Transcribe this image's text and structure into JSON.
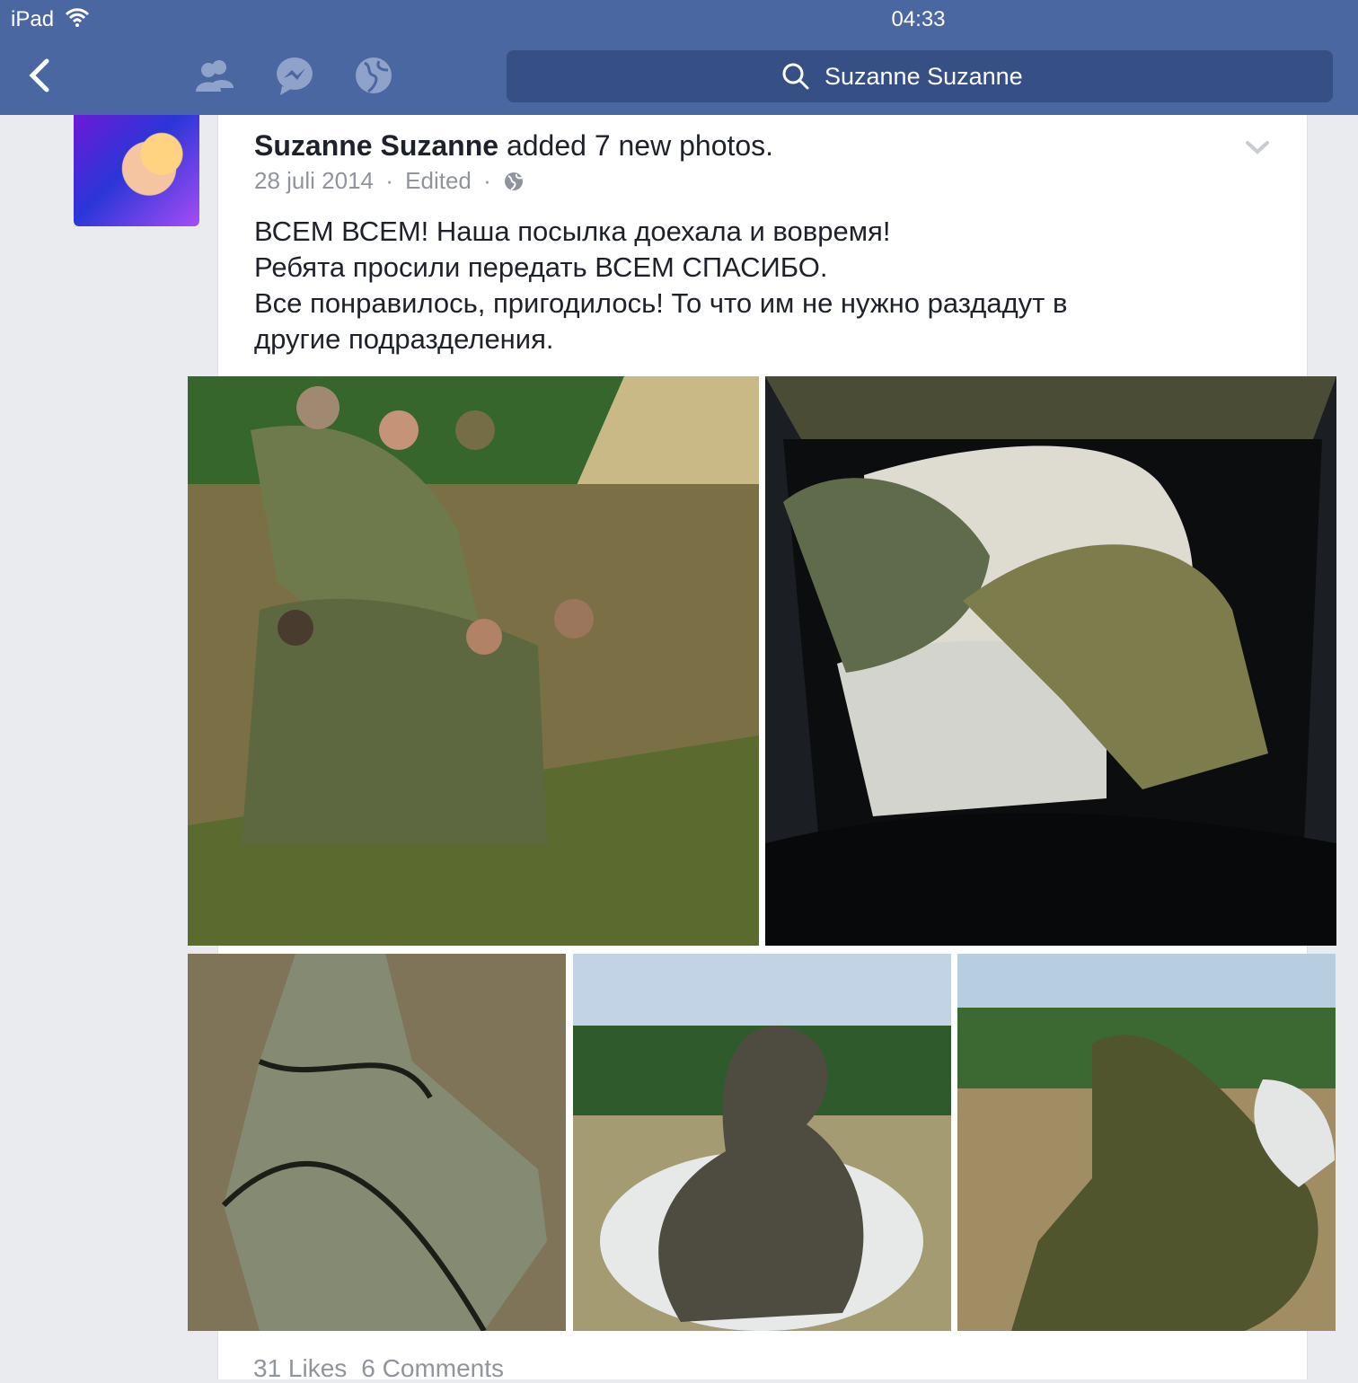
{
  "status_bar": {
    "device": "iPad",
    "time": "04:33"
  },
  "nav": {
    "search_text": "Suzanne Suzanne",
    "icons": [
      "back-icon",
      "friends-icon",
      "messages-icon",
      "globe-icon",
      "search-icon"
    ]
  },
  "post": {
    "author": "Suzanne Suzanne",
    "action": " added 7 new photos.",
    "date": "28 juli 2014",
    "edited": "Edited",
    "lines": [
      "ВСЕМ ВСЕМ! Наша посылка доехала и вовремя!",
      "Ребята просили передать ВСЕМ СПАСИБО.",
      "Все понравилось, пригодилось! То что им не нужно раздадут в",
      "другие подразделения."
    ],
    "likes": "31 Likes",
    "comments": "6 Comments"
  },
  "colors": {
    "facebook_blue": "#4b67a1",
    "search_bg": "#364f85",
    "background": "#e9ebee"
  }
}
